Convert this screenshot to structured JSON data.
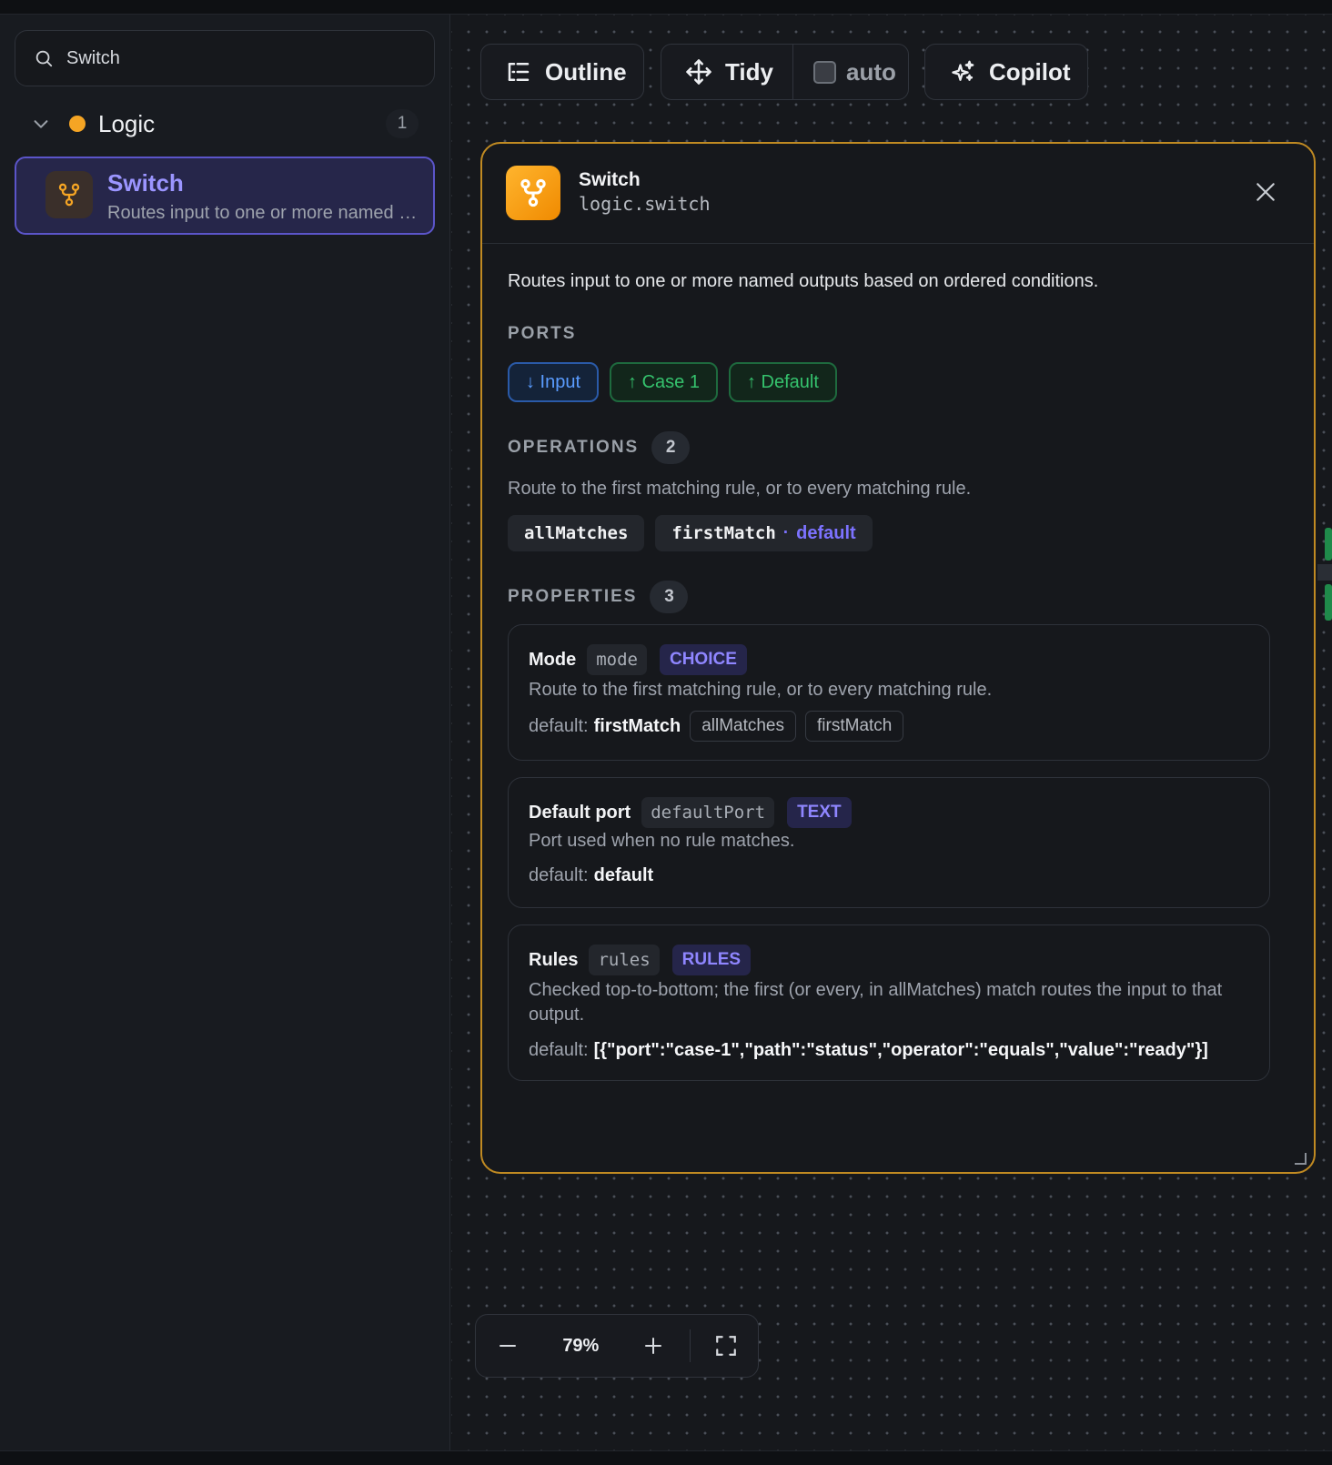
{
  "sidebar": {
    "search": {
      "value": "Switch",
      "icon": "search-icon"
    },
    "group": {
      "label": "Logic",
      "count": "1",
      "dot_color": "#f5a524"
    },
    "item": {
      "title": "Switch",
      "description": "Routes input to one or more named outputs based on ordered conditions."
    }
  },
  "toolbar": {
    "outline_label": "Outline",
    "tidy_label": "Tidy",
    "auto_label": "auto",
    "auto_checked": false,
    "copilot_label": "Copilot"
  },
  "panel": {
    "title": "Switch",
    "type": "logic.switch",
    "description": "Routes input to one or more named outputs based on ordered conditions.",
    "accent": "#f5a524",
    "ports": {
      "heading": "PORTS",
      "input": "↓ Input",
      "case1": "↑ Case 1",
      "default": "↑ Default"
    },
    "operations": {
      "heading": "OPERATIONS",
      "count": "2",
      "description": "Route to the first matching rule, or to every matching rule.",
      "items": [
        "allMatches",
        "firstMatch"
      ],
      "default_marker": "·",
      "default_label": "default"
    },
    "properties": {
      "heading": "PROPERTIES",
      "count": "3",
      "items": [
        {
          "name": "Mode",
          "key": "mode",
          "type": "CHOICE",
          "description": "Route to the first matching rule, or to every matching rule.",
          "default_prefix": "default:",
          "default_value": "firstMatch",
          "options": [
            "allMatches",
            "firstMatch"
          ]
        },
        {
          "name": "Default port",
          "key": "defaultPort",
          "type": "TEXT",
          "description": "Port used when no rule matches.",
          "default_prefix": "default:",
          "default_value": "default"
        },
        {
          "name": "Rules",
          "key": "rules",
          "type": "RULES",
          "description": "Checked top-to-bottom; the first (or every, in allMatches) match routes the input to that output.",
          "default_prefix": "default:",
          "default_value": "[{\"port\":\"case-1\",\"path\":\"status\",\"operator\":\"equals\",\"value\":\"ready\"}]"
        }
      ]
    }
  },
  "zoom": {
    "value": "79%"
  },
  "colors": {
    "accent_purple": "#7c72ff",
    "port_in": "#5a9cff",
    "port_out": "#35c26d",
    "panel_border": "#c08a22"
  }
}
